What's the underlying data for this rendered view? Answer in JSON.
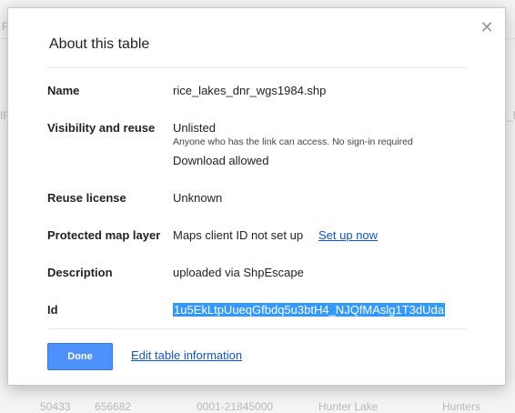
{
  "background": {
    "left_fragment_1": "F",
    "left_fragment_2": "IF",
    "right_fragment": "_N",
    "bottom_row": [
      "50433",
      "656682",
      "0001-21845000",
      "Hunter Lake",
      "Hunters"
    ]
  },
  "dialog": {
    "title": "About this table",
    "close_glyph": "✕",
    "rows": {
      "name": {
        "label": "Name",
        "value": "rice_lakes_dnr_wgs1984.shp"
      },
      "visibility": {
        "label": "Visibility and reuse",
        "value": "Unlisted",
        "note": "Anyone who has the link can access. No sign-in required",
        "download": "Download allowed"
      },
      "license": {
        "label": "Reuse license",
        "value": "Unknown"
      },
      "protected": {
        "label": "Protected map layer",
        "value": "Maps client ID not set up",
        "link": "Set up now"
      },
      "description": {
        "label": "Description",
        "value": "uploaded via ShpEscape"
      },
      "id": {
        "label": "Id",
        "value": "1u5EkLtpUueqGfbdq5u3btH4_NJQfMAslg1T3dUda"
      }
    },
    "done_label": "Done",
    "edit_link": "Edit table information"
  },
  "colors": {
    "primary_button": "#4d90fe",
    "link": "#1155cc",
    "selection": "#3399ff"
  }
}
